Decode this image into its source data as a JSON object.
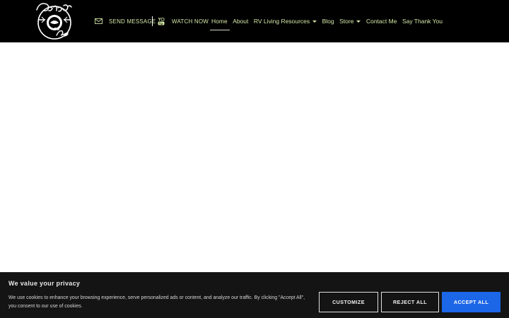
{
  "header": {
    "logo_text": "Carolyn's RV Life",
    "quick_links": [
      {
        "icon": "envelope-icon",
        "label": "SEND MESSAGE"
      },
      {
        "icon": "youtube-icon",
        "label": "WATCH NOW"
      }
    ],
    "nav": [
      {
        "label": "Home",
        "active": true,
        "dropdown": false
      },
      {
        "label": "About",
        "active": false,
        "dropdown": false
      },
      {
        "label": "RV Living Resources",
        "active": false,
        "dropdown": true
      },
      {
        "label": "Blog",
        "active": false,
        "dropdown": false
      },
      {
        "label": "Store",
        "active": false,
        "dropdown": true
      },
      {
        "label": "Contact Me",
        "active": false,
        "dropdown": false
      },
      {
        "label": "Say Thank You",
        "active": false,
        "dropdown": false
      }
    ]
  },
  "cookie": {
    "title": "We value your privacy",
    "text": "We use cookies to enhance your browsing experience, serve personalized ads or content, and analyze our traffic. By clicking \"Accept All\", you consent to our use of cookies.",
    "customize_label": "CUSTOMIZE",
    "reject_label": "REJECT ALL",
    "accept_label": "ACCEPT ALL"
  },
  "colors": {
    "header_bg": "#000000",
    "nav_text": "#d2e6a6",
    "accept_button": "#1c66e8",
    "cookie_bg": "#141414"
  }
}
